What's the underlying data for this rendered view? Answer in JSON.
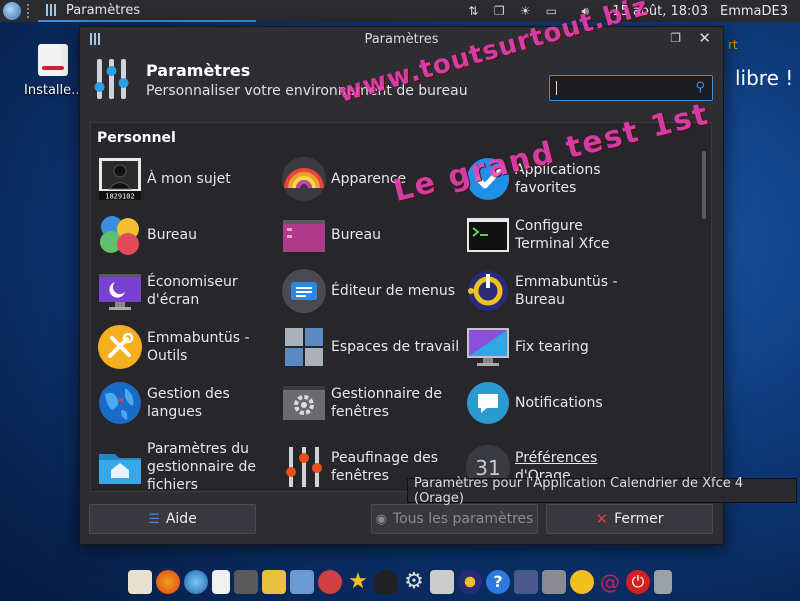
{
  "top_panel": {
    "task_title": "Paramètres",
    "clock": "15 août, 18:03",
    "user": "EmmaDE3"
  },
  "desktop": {
    "install_label": "Installe...",
    "brand_top": "rt",
    "brand_bottom": "libre !"
  },
  "window": {
    "title": "Paramètres",
    "header_title": "Paramètres",
    "header_subtitle": "Personnaliser votre environnement de bureau",
    "search_value": "",
    "category": "Personnel",
    "items": [
      {
        "label": "À mon sujet",
        "icon": "user-id-icon"
      },
      {
        "label": "Apparence",
        "icon": "rainbow-icon"
      },
      {
        "label": "Applications favorites",
        "icon": "check-circle-icon"
      },
      {
        "label": "Bureau",
        "icon": "color-circles-icon"
      },
      {
        "label": "Bureau",
        "icon": "desktop-window-icon"
      },
      {
        "label": "Configure Terminal Xfce",
        "icon": "terminal-icon"
      },
      {
        "label": "Économiseur d'écran",
        "icon": "screensaver-icon"
      },
      {
        "label": "Éditeur de menus",
        "icon": "menu-editor-icon"
      },
      {
        "label": "Emmabuntüs - Bureau",
        "icon": "emmabuntus-desktop-icon"
      },
      {
        "label": "Emmabuntüs - Outils",
        "icon": "tools-icon"
      },
      {
        "label": "Espaces de travail",
        "icon": "workspaces-icon"
      },
      {
        "label": "Fix tearing",
        "icon": "monitor-icon"
      },
      {
        "label": "Gestion des langues",
        "icon": "globe-icon"
      },
      {
        "label": "Gestionnaire de fenêtres",
        "icon": "window-manager-icon"
      },
      {
        "label": "Notifications",
        "icon": "notification-icon"
      },
      {
        "label": "Paramètres du gestionnaire de fichiers",
        "icon": "folder-home-icon"
      },
      {
        "label": "Peaufinage des fenêtres",
        "icon": "tweaks-icon"
      },
      {
        "label": "Préférences d'Orage",
        "icon": "calendar-icon"
      }
    ],
    "id_number": "1829102",
    "calendar_day": "31",
    "help_button": "Aide",
    "all_settings_button": "Tous les paramètres",
    "close_button": "Fermer",
    "tooltip": "Paramètres pour l'Application Calendrier de Xfce 4 (Orage)"
  },
  "watermark": {
    "line1": "www.toutsurtout.biz",
    "line2": "Le grand test 1st"
  },
  "colors": {
    "accent": "#3c8ee0",
    "window_bg": "#2d2d32",
    "panel_bg": "#2b2b30",
    "close_red": "#e04040",
    "watermark": "#f040b8"
  }
}
